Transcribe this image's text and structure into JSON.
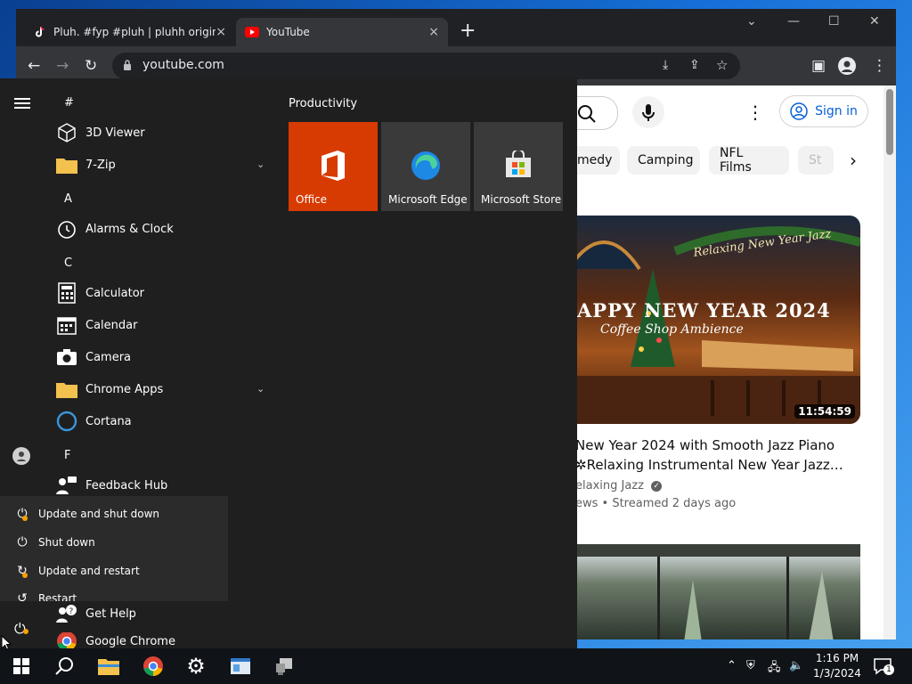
{
  "browser": {
    "tabs": [
      {
        "label": "Pluh. #fyp #pluh | pluhh original",
        "close": "×"
      },
      {
        "label": "YouTube",
        "close": "×"
      }
    ],
    "new_tab": "+",
    "url": "youtube.com"
  },
  "youtube": {
    "sign_in": "Sign in",
    "chips": [
      "medy",
      "Camping",
      "NFL Films",
      "St"
    ],
    "video1": {
      "thumb_text1": "APPY NEW YEAR 2024",
      "thumb_text2": "Coffee Shop Ambience",
      "thumb_tag": "Relaxing New Year Jazz",
      "duration": "11:54:59",
      "title_line1": "New Year 2024 with Smooth Jazz Piano",
      "title_line2": "Relaxing Instrumental New Year Jazz…",
      "channel": "elaxing Jazz",
      "meta": "ews • Streamed 2 days ago"
    }
  },
  "start_menu": {
    "letters": {
      "hash": "#",
      "a": "A",
      "c": "C",
      "f": "F"
    },
    "apps": {
      "viewer3d": "3D Viewer",
      "zip": "7-Zip",
      "alarms": "Alarms & Clock",
      "calculator": "Calculator",
      "calendar": "Calendar",
      "camera": "Camera",
      "chrome_apps": "Chrome Apps",
      "cortana": "Cortana",
      "feedback": "Feedback Hub",
      "gethelp": "Get Help",
      "chrome": "Google Chrome"
    },
    "group_title": "Productivity",
    "tiles": {
      "office": "Office",
      "edge": "Microsoft Edge",
      "store": "Microsoft Store"
    },
    "power_menu": [
      "Update and shut down",
      "Shut down",
      "Update and restart",
      "Restart"
    ]
  },
  "taskbar": {
    "time": "1:16 PM",
    "date": "1/3/2024",
    "notif_count": "1"
  },
  "colors": {
    "office_tile": "#d83b01",
    "tile_bg": "#3a3a3a",
    "youtube_red": "#ff0000",
    "accent_blue": "#065fd4",
    "update_orange": "#f7a000"
  }
}
